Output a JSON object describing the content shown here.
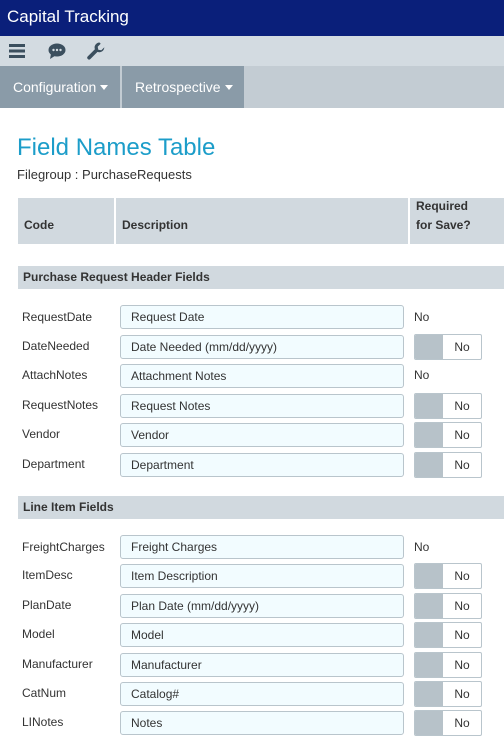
{
  "app_title": "Capital Tracking",
  "toolbar": {
    "icons": [
      "menu-icon",
      "chat-icon",
      "wrench-icon"
    ]
  },
  "menu": {
    "configuration": "Configuration",
    "retrospective": "Retrospective"
  },
  "page": {
    "title": "Field Names Table",
    "filegroup": "Filegroup : PurchaseRequests"
  },
  "table_headers": {
    "code": "Code",
    "description": "Description",
    "required_line1": "Required",
    "required_line2": "for Save?"
  },
  "sections": {
    "header": {
      "title": "Purchase Request Header Fields",
      "rows": [
        {
          "code": "RequestDate",
          "description": "Request Date",
          "required": "No",
          "toggle": false
        },
        {
          "code": "DateNeeded",
          "description": "Date Needed (mm/dd/yyyy)",
          "required": "No",
          "toggle": true
        },
        {
          "code": "AttachNotes",
          "description": "Attachment Notes",
          "required": "No",
          "toggle": false
        },
        {
          "code": "RequestNotes",
          "description": "Request Notes",
          "required": "No",
          "toggle": true
        },
        {
          "code": "Vendor",
          "description": "Vendor",
          "required": "No",
          "toggle": true
        },
        {
          "code": "Department",
          "description": "Department",
          "required": "No",
          "toggle": true
        }
      ]
    },
    "line": {
      "title": "Line Item Fields",
      "rows": [
        {
          "code": "FreightCharges",
          "description": "Freight Charges",
          "required": "No",
          "toggle": false
        },
        {
          "code": "ItemDesc",
          "description": "Item Description",
          "required": "No",
          "toggle": true
        },
        {
          "code": "PlanDate",
          "description": "Plan Date (mm/dd/yyyy)",
          "required": "No",
          "toggle": true
        },
        {
          "code": "Model",
          "description": "Model",
          "required": "No",
          "toggle": true
        },
        {
          "code": "Manufacturer",
          "description": "Manufacturer",
          "required": "No",
          "toggle": true
        },
        {
          "code": "CatNum",
          "description": "Catalog#",
          "required": "No",
          "toggle": true
        },
        {
          "code": "LINotes",
          "description": "Notes",
          "required": "No",
          "toggle": true
        }
      ]
    }
  },
  "colors": {
    "titlebar": "#0a1f7a",
    "accent": "#1c9dc9",
    "menu_button": "#8a9ba8",
    "header_bg": "#d1d9df"
  }
}
